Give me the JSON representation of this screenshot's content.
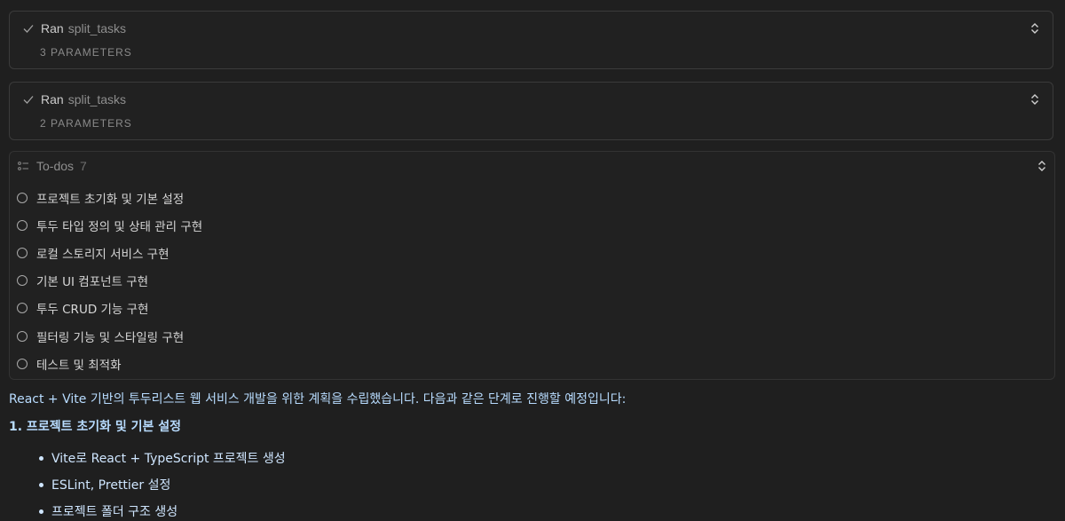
{
  "tool_calls": [
    {
      "status": "Ran",
      "name": "split_tasks",
      "params": "3 PARAMETERS"
    },
    {
      "status": "Ran",
      "name": "split_tasks",
      "params": "2 PARAMETERS"
    }
  ],
  "todos": {
    "title": "To-dos",
    "count": "7",
    "items": [
      "프로젝트 초기화 및 기본 설정",
      "투두 타입 정의 및 상태 관리 구현",
      "로컬 스토리지 서비스 구현",
      "기본 UI 컴포넌트 구현",
      "투두 CRUD 기능 구현",
      "필터링 기능 및 스타일링 구현",
      "테스트 및 최적화"
    ]
  },
  "message": {
    "intro": "React + Vite 기반의 투두리스트 웹 서비스 개발을 위한 계획을 수립했습니다. 다음과 같은 단계로 진행할 예정입니다:",
    "section_heading": "1. 프로젝트 초기화 및 기본 설정",
    "bullets": [
      "Vite로 React + TypeScript 프로젝트 생성",
      "ESLint, Prettier 설정",
      "프로젝트 폴더 구조 생성"
    ]
  },
  "icons": {
    "check": "check-icon",
    "expand": "chevron-up-down-icon",
    "list": "list-icon",
    "todo": "circle-icon"
  }
}
